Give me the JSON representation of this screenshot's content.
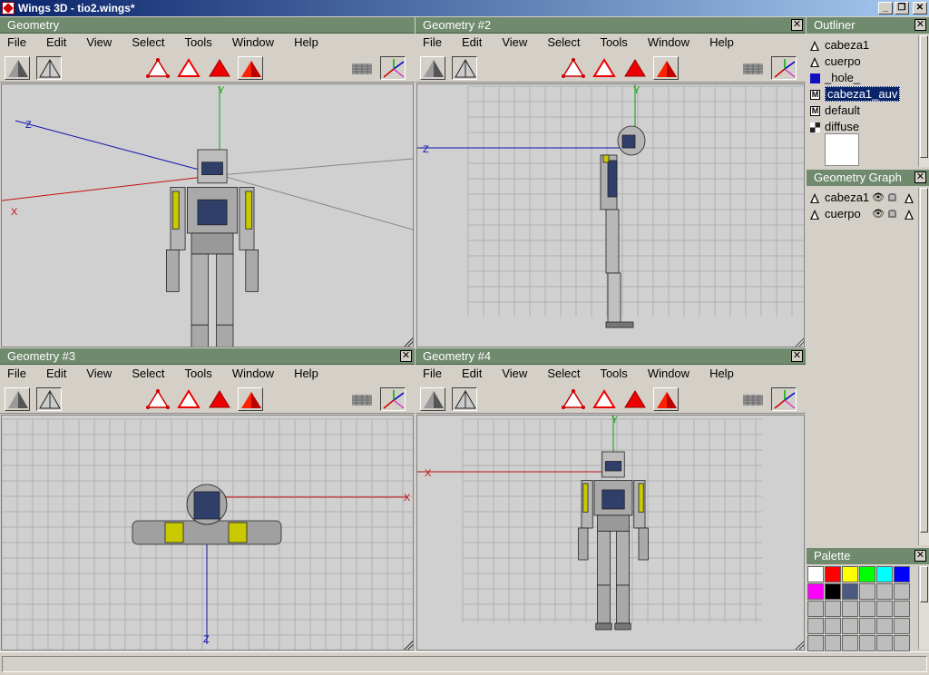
{
  "window": {
    "title": "Wings 3D - tio2.wings*",
    "buttons": [
      "_",
      "❐",
      "✕"
    ]
  },
  "menu": [
    "File",
    "Edit",
    "View",
    "Select",
    "Tools",
    "Window",
    "Help"
  ],
  "viewports": [
    {
      "title": "Geometry"
    },
    {
      "title": "Geometry #2"
    },
    {
      "title": "Geometry #3"
    },
    {
      "title": "Geometry #4"
    }
  ],
  "axes": {
    "x": "X",
    "y": "Y",
    "z": "Z"
  },
  "colors": {
    "x_axis": "#c01010",
    "y_axis": "#10a010",
    "z_axis": "#1010b0",
    "header": "#6f8a6c",
    "select_blue": "#0a246a"
  },
  "outliner": {
    "title": "Outliner",
    "items": [
      {
        "label": "cabeza1",
        "icon": "object-icon"
      },
      {
        "label": "cuerpo",
        "icon": "object-icon"
      },
      {
        "label": "_hole_",
        "icon": "material-blue-icon"
      },
      {
        "label": "cabeza1_auv",
        "icon": "material-icon",
        "selected": true
      },
      {
        "label": "default",
        "icon": "material-icon"
      },
      {
        "label": "diffuse",
        "icon": "image-icon"
      }
    ]
  },
  "geometry_graph": {
    "title": "Geometry Graph",
    "items": [
      {
        "label": "cabeza1"
      },
      {
        "label": "cuerpo"
      }
    ]
  },
  "palette": {
    "title": "Palette",
    "swatches": [
      "#ffffff",
      "#ff0000",
      "#ffff00",
      "#00ff00",
      "#00ffff",
      "#0000ff",
      "#ff00ff",
      "#000000",
      "#4a5a80"
    ]
  }
}
